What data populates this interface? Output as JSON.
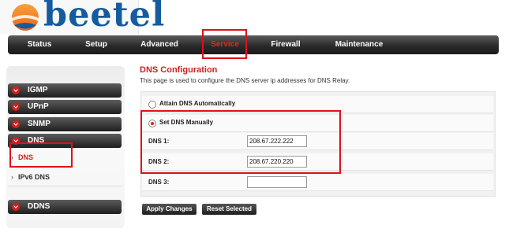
{
  "brand": {
    "name": "beetel"
  },
  "topnav": {
    "items": [
      "Status",
      "Setup",
      "Advanced",
      "Service",
      "Firewall",
      "Maintenance"
    ],
    "active": "Service"
  },
  "sidebar": {
    "items": [
      {
        "label": "IGMP"
      },
      {
        "label": "UPnP"
      },
      {
        "label": "SNMP"
      },
      {
        "label": "DNS"
      }
    ],
    "dns_sub": [
      {
        "label": "DNS",
        "active": true
      },
      {
        "label": "IPv6 DNS",
        "active": false
      }
    ],
    "ddns": {
      "label": "DDNS"
    }
  },
  "main": {
    "title": "DNS Configuration",
    "description": "This page is used to configure the DNS server ip addresses for DNS Relay.",
    "options": {
      "auto_label": "Attain DNS Automatically",
      "manual_label": "Set DNS Manually",
      "selected": "manual"
    },
    "fields": [
      {
        "label": "DNS 1:",
        "value": "208.67.222.222"
      },
      {
        "label": "DNS 2:",
        "value": "208.67.220.220"
      },
      {
        "label": "DNS 3:",
        "value": ""
      }
    ],
    "buttons": {
      "apply": "Apply Changes",
      "reset": "Reset Selected"
    }
  },
  "colors": {
    "accent": "#d0211c",
    "brand": "#155c9e",
    "highlight": "#e0101a"
  }
}
